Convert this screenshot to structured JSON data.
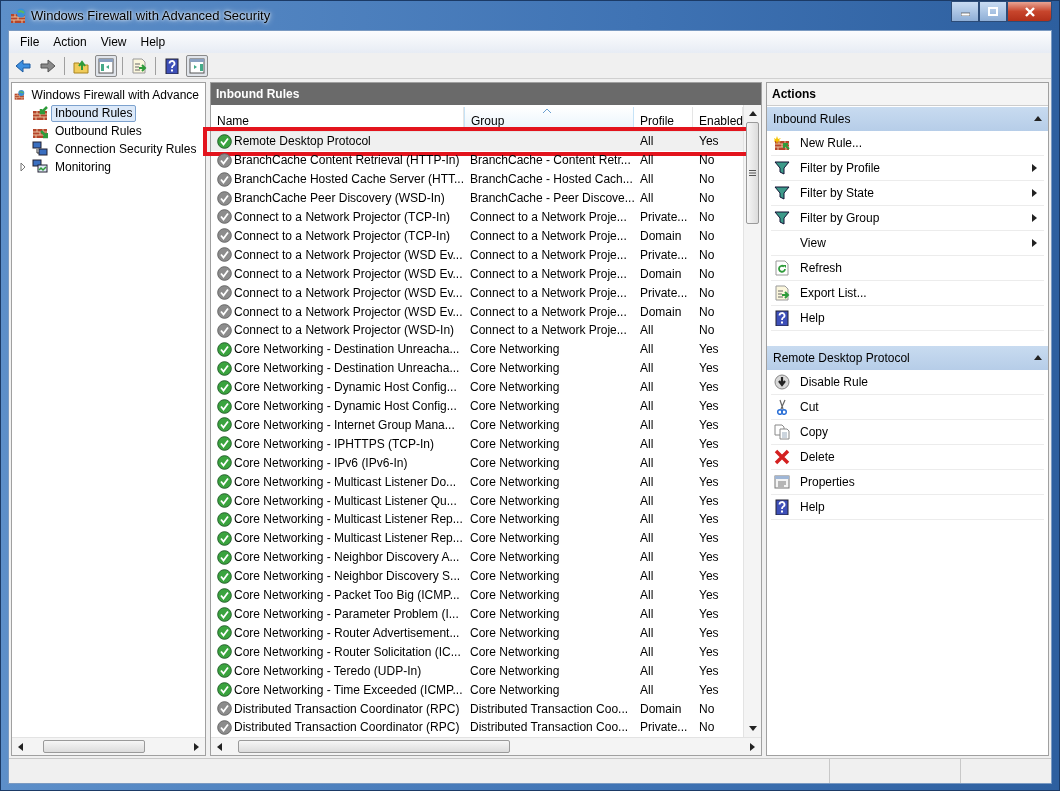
{
  "window": {
    "title": "Windows Firewall with Advanced Security"
  },
  "menu": [
    "File",
    "Action",
    "View",
    "Help"
  ],
  "toolbar": [
    {
      "kind": "back",
      "pressed": false
    },
    {
      "kind": "forward",
      "pressed": false
    },
    {
      "kind": "up",
      "pressed": false
    },
    {
      "kind": "tree",
      "pressed": true
    },
    {
      "kind": "export",
      "pressed": false
    },
    {
      "kind": "help",
      "pressed": false
    },
    {
      "kind": "pane",
      "pressed": true
    }
  ],
  "tree": {
    "label": "Windows Firewall with Advance",
    "children": [
      {
        "label": "Inbound Rules",
        "kind": "inbound",
        "selected": true,
        "collapsed": false
      },
      {
        "label": "Outbound Rules",
        "kind": "outbound",
        "selected": false,
        "collapsed": false
      },
      {
        "label": "Connection Security Rules",
        "kind": "connection",
        "selected": false,
        "collapsed": false
      },
      {
        "label": "Monitoring",
        "kind": "monitoring",
        "selected": false,
        "collapsed": true
      }
    ]
  },
  "rules": {
    "title": "Inbound Rules",
    "columns": [
      {
        "label": "Name",
        "sorted": false
      },
      {
        "label": "Group",
        "sorted": true
      },
      {
        "label": "Profile",
        "sorted": false
      },
      {
        "label": "Enabled",
        "sorted": false
      }
    ],
    "rows": [
      {
        "name": "Remote Desktop Protocol",
        "group": "",
        "profile": "All",
        "enabled": "Yes",
        "on": true,
        "outlined": true
      },
      {
        "name": "BranchCache Content Retrieval (HTTP-In)",
        "group": "BranchCache - Content Retr...",
        "profile": "All",
        "enabled": "No",
        "on": false,
        "outlined": false
      },
      {
        "name": "BranchCache Hosted Cache Server (HTT...",
        "group": "BranchCache - Hosted Cach...",
        "profile": "All",
        "enabled": "No",
        "on": false,
        "outlined": false
      },
      {
        "name": "BranchCache Peer Discovery (WSD-In)",
        "group": "BranchCache - Peer Discove...",
        "profile": "All",
        "enabled": "No",
        "on": false,
        "outlined": false
      },
      {
        "name": "Connect to a Network Projector (TCP-In)",
        "group": "Connect to a Network Proje...",
        "profile": "Private...",
        "enabled": "No",
        "on": false,
        "outlined": false
      },
      {
        "name": "Connect to a Network Projector (TCP-In)",
        "group": "Connect to a Network Proje...",
        "profile": "Domain",
        "enabled": "No",
        "on": false,
        "outlined": false
      },
      {
        "name": "Connect to a Network Projector (WSD Ev...",
        "group": "Connect to a Network Proje...",
        "profile": "Private...",
        "enabled": "No",
        "on": false,
        "outlined": false
      },
      {
        "name": "Connect to a Network Projector (WSD Ev...",
        "group": "Connect to a Network Proje...",
        "profile": "Domain",
        "enabled": "No",
        "on": false,
        "outlined": false
      },
      {
        "name": "Connect to a Network Projector (WSD Ev...",
        "group": "Connect to a Network Proje...",
        "profile": "Private...",
        "enabled": "No",
        "on": false,
        "outlined": false
      },
      {
        "name": "Connect to a Network Projector (WSD Ev...",
        "group": "Connect to a Network Proje...",
        "profile": "Domain",
        "enabled": "No",
        "on": false,
        "outlined": false
      },
      {
        "name": "Connect to a Network Projector (WSD-In)",
        "group": "Connect to a Network Proje...",
        "profile": "All",
        "enabled": "No",
        "on": false,
        "outlined": false
      },
      {
        "name": "Core Networking - Destination Unreacha...",
        "group": "Core Networking",
        "profile": "All",
        "enabled": "Yes",
        "on": true,
        "outlined": false
      },
      {
        "name": "Core Networking - Destination Unreacha...",
        "group": "Core Networking",
        "profile": "All",
        "enabled": "Yes",
        "on": true,
        "outlined": false
      },
      {
        "name": "Core Networking - Dynamic Host Config...",
        "group": "Core Networking",
        "profile": "All",
        "enabled": "Yes",
        "on": true,
        "outlined": false
      },
      {
        "name": "Core Networking - Dynamic Host Config...",
        "group": "Core Networking",
        "profile": "All",
        "enabled": "Yes",
        "on": true,
        "outlined": false
      },
      {
        "name": "Core Networking - Internet Group Mana...",
        "group": "Core Networking",
        "profile": "All",
        "enabled": "Yes",
        "on": true,
        "outlined": false
      },
      {
        "name": "Core Networking - IPHTTPS (TCP-In)",
        "group": "Core Networking",
        "profile": "All",
        "enabled": "Yes",
        "on": true,
        "outlined": false
      },
      {
        "name": "Core Networking - IPv6 (IPv6-In)",
        "group": "Core Networking",
        "profile": "All",
        "enabled": "Yes",
        "on": true,
        "outlined": false
      },
      {
        "name": "Core Networking - Multicast Listener Do...",
        "group": "Core Networking",
        "profile": "All",
        "enabled": "Yes",
        "on": true,
        "outlined": false
      },
      {
        "name": "Core Networking - Multicast Listener Qu...",
        "group": "Core Networking",
        "profile": "All",
        "enabled": "Yes",
        "on": true,
        "outlined": false
      },
      {
        "name": "Core Networking - Multicast Listener Rep...",
        "group": "Core Networking",
        "profile": "All",
        "enabled": "Yes",
        "on": true,
        "outlined": false
      },
      {
        "name": "Core Networking - Multicast Listener Rep...",
        "group": "Core Networking",
        "profile": "All",
        "enabled": "Yes",
        "on": true,
        "outlined": false
      },
      {
        "name": "Core Networking - Neighbor Discovery A...",
        "group": "Core Networking",
        "profile": "All",
        "enabled": "Yes",
        "on": true,
        "outlined": false
      },
      {
        "name": "Core Networking - Neighbor Discovery S...",
        "group": "Core Networking",
        "profile": "All",
        "enabled": "Yes",
        "on": true,
        "outlined": false
      },
      {
        "name": "Core Networking - Packet Too Big (ICMP...",
        "group": "Core Networking",
        "profile": "All",
        "enabled": "Yes",
        "on": true,
        "outlined": false
      },
      {
        "name": "Core Networking - Parameter Problem (I...",
        "group": "Core Networking",
        "profile": "All",
        "enabled": "Yes",
        "on": true,
        "outlined": false
      },
      {
        "name": "Core Networking - Router Advertisement...",
        "group": "Core Networking",
        "profile": "All",
        "enabled": "Yes",
        "on": true,
        "outlined": false
      },
      {
        "name": "Core Networking - Router Solicitation (IC...",
        "group": "Core Networking",
        "profile": "All",
        "enabled": "Yes",
        "on": true,
        "outlined": false
      },
      {
        "name": "Core Networking - Teredo (UDP-In)",
        "group": "Core Networking",
        "profile": "All",
        "enabled": "Yes",
        "on": true,
        "outlined": false
      },
      {
        "name": "Core Networking - Time Exceeded (ICMP...",
        "group": "Core Networking",
        "profile": "All",
        "enabled": "Yes",
        "on": true,
        "outlined": false
      },
      {
        "name": "Distributed Transaction Coordinator (RPC)",
        "group": "Distributed Transaction Coo...",
        "profile": "Domain",
        "enabled": "No",
        "on": false,
        "outlined": false
      },
      {
        "name": "Distributed Transaction Coordinator (RPC)",
        "group": "Distributed Transaction Coo...",
        "profile": "Private...",
        "enabled": "No",
        "on": false,
        "outlined": false
      }
    ]
  },
  "actions": {
    "title": "Actions",
    "sections": [
      {
        "title": "Inbound Rules",
        "items": [
          {
            "label": "New Rule...",
            "kind": "newrule",
            "submenu": false
          },
          {
            "label": "Filter by Profile",
            "kind": "filter",
            "submenu": true
          },
          {
            "label": "Filter by State",
            "kind": "filter",
            "submenu": true
          },
          {
            "label": "Filter by Group",
            "kind": "filter",
            "submenu": true
          },
          {
            "label": "View",
            "kind": "plain",
            "submenu": true
          },
          {
            "label": "Refresh",
            "kind": "refresh",
            "submenu": false
          },
          {
            "label": "Export List...",
            "kind": "export",
            "submenu": false
          },
          {
            "label": "Help",
            "kind": "help",
            "submenu": false
          }
        ]
      },
      {
        "title": "Remote Desktop Protocol",
        "items": [
          {
            "label": "Disable Rule",
            "kind": "disable",
            "submenu": false
          },
          {
            "label": "Cut",
            "kind": "cut",
            "submenu": false
          },
          {
            "label": "Copy",
            "kind": "copy",
            "submenu": false
          },
          {
            "label": "Delete",
            "kind": "delete",
            "submenu": false
          },
          {
            "label": "Properties",
            "kind": "properties",
            "submenu": false
          },
          {
            "label": "Help",
            "kind": "help",
            "submenu": false
          }
        ]
      }
    ]
  }
}
